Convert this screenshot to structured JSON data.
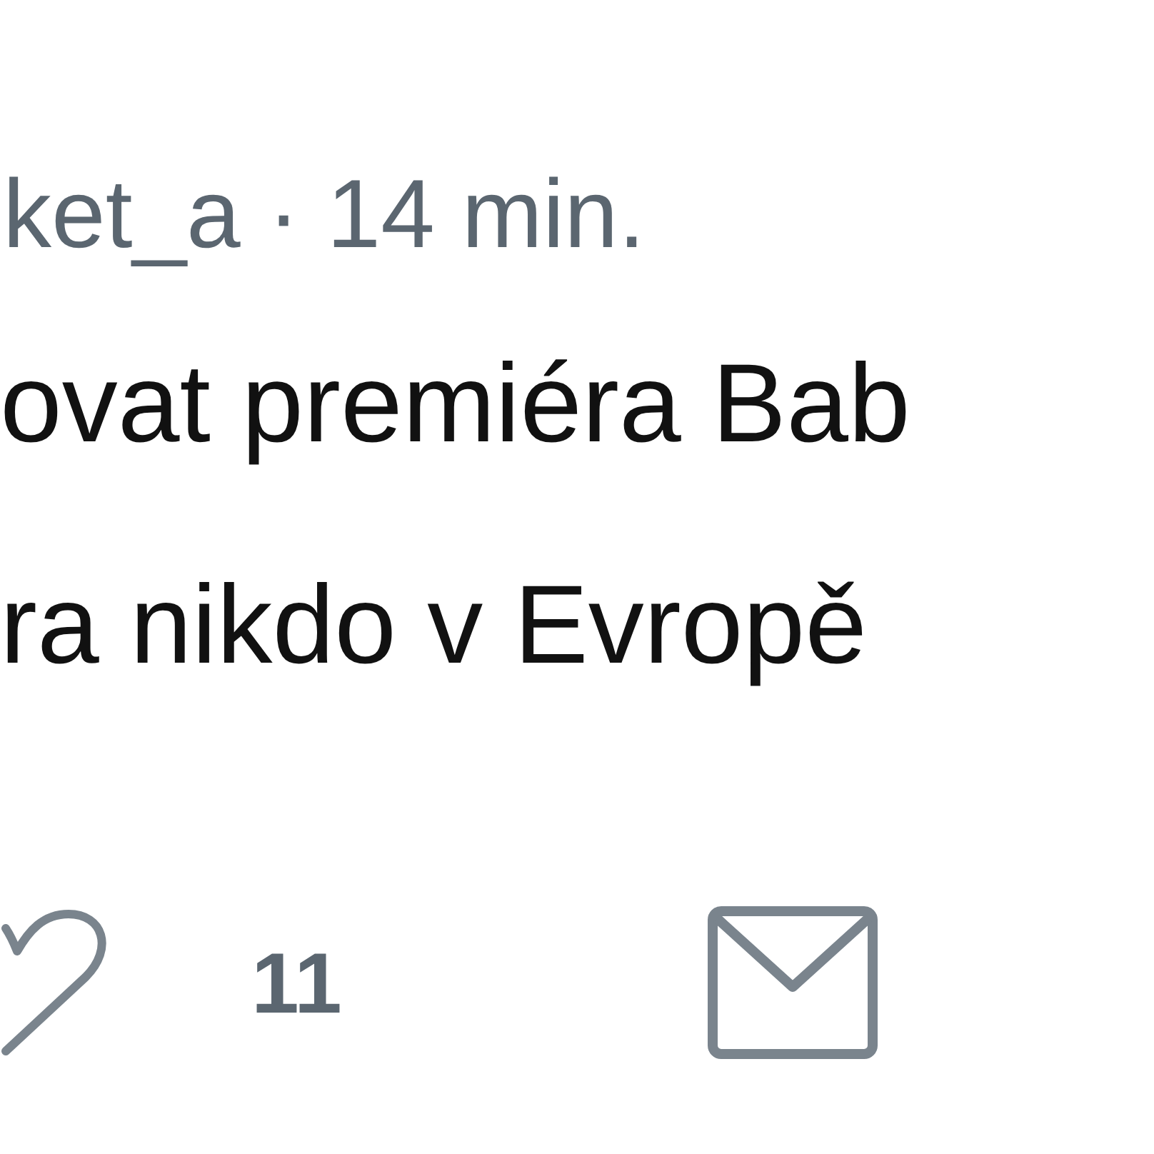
{
  "tweet": {
    "meta": "ket_a · 14 min.",
    "text_lines": [
      "ovat premiéra Bab",
      "ra nikdo v Evropě"
    ],
    "like_count": "11"
  }
}
